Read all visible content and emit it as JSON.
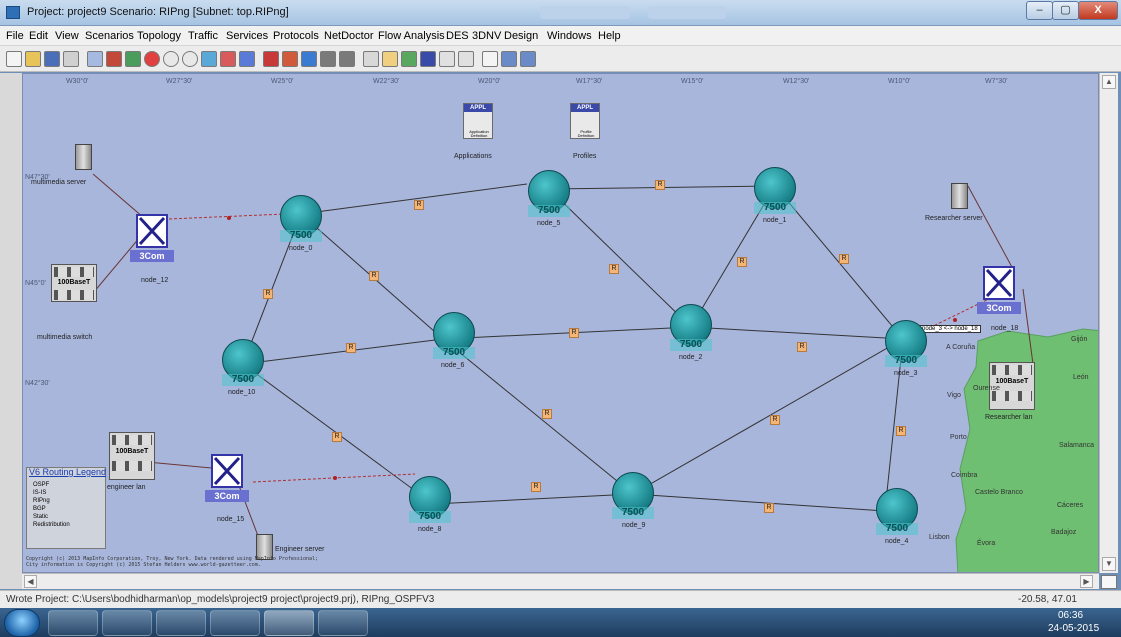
{
  "window": {
    "title": "Project: project9 Scenario: RIPng  [Subnet: top.RIPng]",
    "min": "–",
    "max": "▢",
    "close": "X"
  },
  "menu": [
    "File",
    "Edit",
    "View",
    "Scenarios",
    "Topology",
    "Traffic",
    "Services",
    "Protocols",
    "NetDoctor",
    "Flow Analysis",
    "DES",
    "3DNV",
    "Design",
    "Windows",
    "Help"
  ],
  "graticule": {
    "lon": [
      "W30°0'",
      "W27°30'",
      "W25°0'",
      "W22°30'",
      "W20°0'",
      "W17°30'",
      "W15°0'",
      "W12°30'",
      "W10°0'",
      "W7°30'"
    ],
    "lat": [
      "N47°30'",
      "N45°0'",
      "N42°30'"
    ]
  },
  "objects": {
    "applications": {
      "label": "Applications",
      "header": "APPL",
      "sub": "Application Definition"
    },
    "profiles": {
      "label": "Profiles",
      "header": "APPL",
      "sub": "Profile Definition"
    }
  },
  "routers": [
    {
      "id": "node_0",
      "model": "7500"
    },
    {
      "id": "node_5",
      "model": "7500"
    },
    {
      "id": "node_1",
      "model": "7500"
    },
    {
      "id": "node_6",
      "model": "7500"
    },
    {
      "id": "node_2",
      "model": "7500"
    },
    {
      "id": "node_3",
      "model": "7500"
    },
    {
      "id": "node_10",
      "model": "7500"
    },
    {
      "id": "node_8",
      "model": "7500"
    },
    {
      "id": "node_9",
      "model": "7500"
    },
    {
      "id": "node_4",
      "model": "7500"
    }
  ],
  "switches": [
    {
      "id": "node_12",
      "brand": "3Com"
    },
    {
      "id": "node_15",
      "brand": "3Com"
    },
    {
      "id": "node_18",
      "brand": "3Com"
    }
  ],
  "servers": [
    "multimedia server",
    "Researcher server",
    "Engineer server"
  ],
  "lans": [
    {
      "name": "multimedia switch",
      "badge": "100BaseT"
    },
    {
      "name": "engineer lan",
      "badge": "100BaseT"
    },
    {
      "name": "Researcher lan",
      "badge": "100BaseT"
    }
  ],
  "link_badge": "R",
  "link_tooltip": "node_3 <-> node_18",
  "legend": {
    "title": "V6 Routing Legend",
    "items": [
      "OSPF",
      "IS-IS",
      "RIPng",
      "BGP",
      "Static",
      "Redistribution"
    ]
  },
  "cities": [
    "Gijón",
    "A Coruña",
    "León",
    "Ourense",
    "Vigo",
    "Porto",
    "Salamanca",
    "Coimbra",
    "Castelo Branco",
    "Cáceres",
    "Badajoz",
    "Lisbon",
    "Évora"
  ],
  "copyright": [
    "Copyright (c) 2013 MapInfo Corporation, Troy, New York.  Data rendered using MapInfo Professional;",
    "City information is Copyright (c) 2015 Stefan Helders www.world-gazetteer.com."
  ],
  "status": {
    "message": "Wrote Project: C:\\Users\\bodhidharman\\op_models\\project9 project\\project9.prj), RIPng_OSPFV3",
    "coords": "-20.58, 47.01"
  },
  "taskbar": {
    "time": "06:36",
    "date": "24-05-2015"
  },
  "colors": {
    "router": "#1f9aa3",
    "switch": "#3434a8",
    "link_badge": "#f5b574",
    "land": "#6fbf73",
    "map_sea": "#a8b6dc"
  }
}
